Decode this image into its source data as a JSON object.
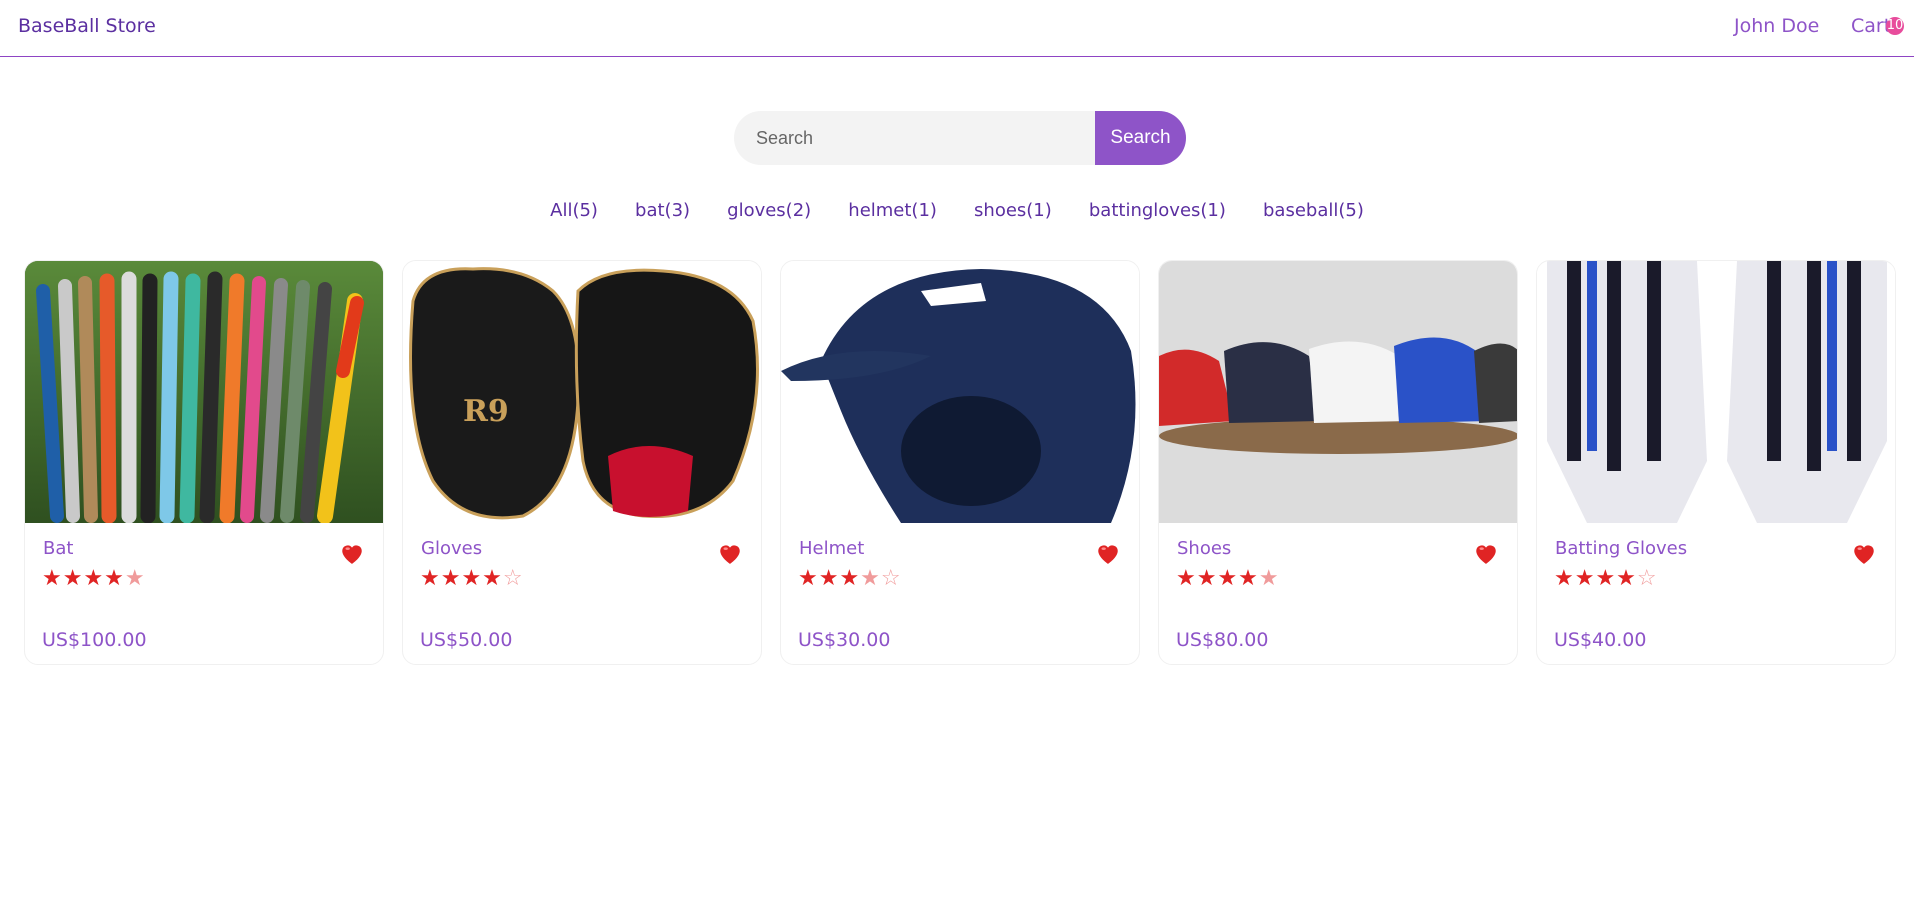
{
  "header": {
    "brand": "BaseBall Store",
    "user": "John Doe",
    "cart_label": "Cart",
    "cart_count": "10"
  },
  "search": {
    "placeholder": "Search",
    "button_label": "Search"
  },
  "categories": [
    "All(5)",
    "bat(3)",
    "gloves(2)",
    "helmet(1)",
    "shoes(1)",
    "battingloves(1)",
    "baseball(5)"
  ],
  "products": [
    {
      "name": "Bat",
      "rating": 4.5,
      "price": "US$100.00"
    },
    {
      "name": "Gloves",
      "rating": 4,
      "price": "US$50.00"
    },
    {
      "name": "Helmet",
      "rating": 3.5,
      "price": "US$30.00"
    },
    {
      "name": "Shoes",
      "rating": 4.5,
      "price": "US$80.00"
    },
    {
      "name": "Batting Gloves",
      "rating": 4,
      "price": "US$40.00"
    }
  ],
  "colors": {
    "accent": "#8e54c8",
    "brand_text": "#5b2fa0",
    "star": "#e02424",
    "heart": "#e02424",
    "badge": "#e84c9c"
  }
}
